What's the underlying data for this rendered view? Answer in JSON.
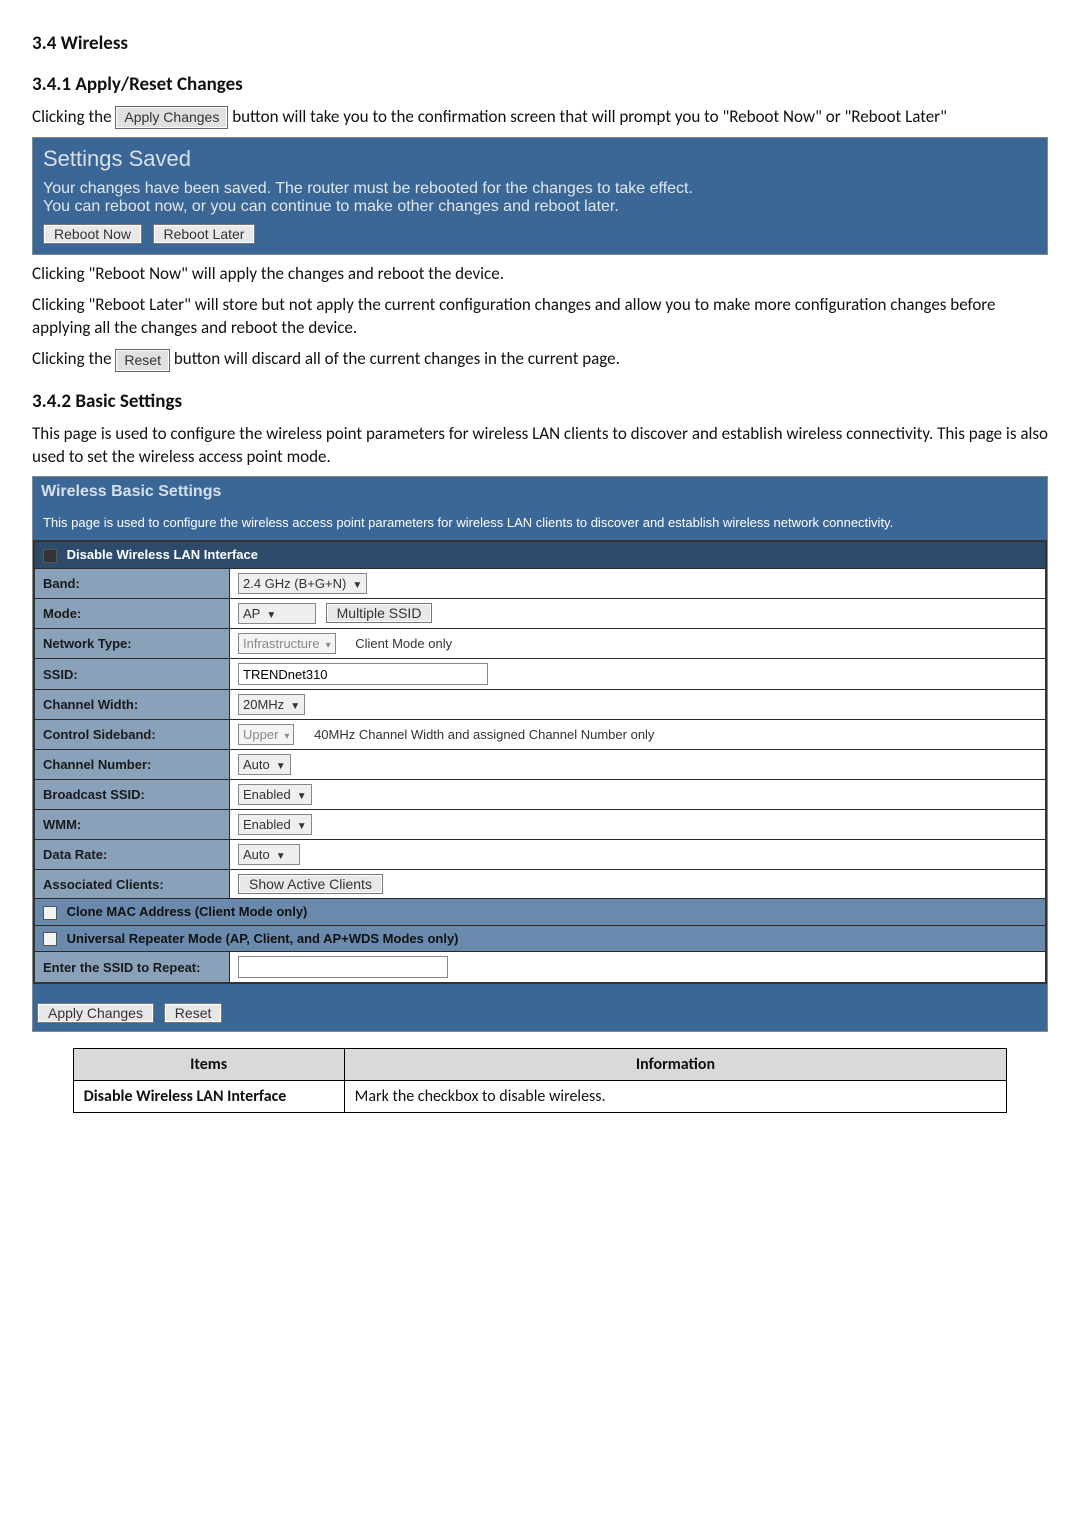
{
  "headings": {
    "h1": "3.4  Wireless",
    "h2": "3.4.1  Apply/Reset Changes",
    "h3": "3.4.2  Basic Settings"
  },
  "paragraphs": {
    "p1a": "Clicking the ",
    "p1_btn": "Apply Changes",
    "p1b": " button will take you to the confirmation screen that will prompt you to \"Reboot Now\" or \"Reboot Later\"",
    "p2": "Clicking \"Reboot Now\" will apply the changes and reboot the device.",
    "p3": "Clicking \"Reboot Later\" will store but not apply the current configuration changes and allow you to make more configuration changes before applying all the changes and reboot the device.",
    "p4a": "Clicking the ",
    "p4_btn": "Reset",
    "p4b": " button will discard all of the current changes in the current page.",
    "p5": "This page is used to configure the wireless point parameters for wireless LAN clients to discover and establish wireless connectivity. This page is also used to set the wireless access point mode."
  },
  "settings_saved": {
    "title": "Settings Saved",
    "line1": "Your changes have been saved. The router must be rebooted for the changes to take effect.",
    "line2": "You can reboot now, or you can continue to make other changes and reboot later.",
    "reboot_now": "Reboot Now",
    "reboot_later": "Reboot Later"
  },
  "wbs": {
    "title": "Wireless Basic Settings",
    "desc": "This page is used to configure the wireless access point parameters for wireless LAN clients to discover and establish wireless network connectivity.",
    "disable_label": "Disable Wireless LAN Interface",
    "rows": {
      "band_label": "Band:",
      "band_value": "2.4 GHz (B+G+N)",
      "mode_label": "Mode:",
      "mode_value": "AP",
      "multiple_ssid_btn": "Multiple SSID",
      "network_type_label": "Network Type:",
      "network_type_value": "Infrastructure",
      "network_type_note": "Client Mode only",
      "ssid_label": "SSID:",
      "ssid_value": "TRENDnet310",
      "channel_width_label": "Channel Width:",
      "channel_width_value": "20MHz",
      "control_sideband_label": "Control Sideband:",
      "control_sideband_value": "Upper",
      "control_sideband_note": "40MHz Channel Width and assigned Channel Number only",
      "channel_number_label": "Channel Number:",
      "channel_number_value": "Auto",
      "broadcast_ssid_label": "Broadcast SSID:",
      "broadcast_ssid_value": "Enabled",
      "wmm_label": "WMM:",
      "wmm_value": "Enabled",
      "data_rate_label": "Data Rate:",
      "data_rate_value": "Auto",
      "assoc_clients_label": "Associated Clients:",
      "show_active_btn": "Show Active Clients",
      "clone_mac_label": "Clone MAC Address (Client Mode only)",
      "universal_repeater_label": "Universal Repeater Mode (AP, Client, and AP+WDS Modes only)",
      "enter_ssid_label": "Enter the SSID to Repeat:"
    },
    "apply_btn": "Apply Changes",
    "reset_btn": "Reset"
  },
  "info_table": {
    "header_items": "Items",
    "header_info": "Information",
    "row1_item": "Disable Wireless LAN Interface",
    "row1_info": "Mark the checkbox to disable wireless."
  }
}
